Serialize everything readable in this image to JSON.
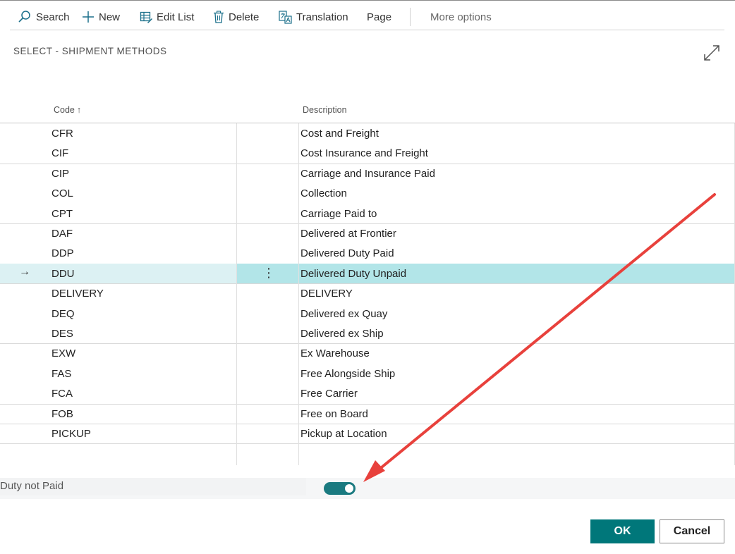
{
  "toolbar": {
    "search": "Search",
    "new": "New",
    "edit_list": "Edit List",
    "delete": "Delete",
    "translation": "Translation",
    "page": "Page",
    "more_options": "More options"
  },
  "page": {
    "title": "SELECT - SHIPMENT METHODS"
  },
  "grid": {
    "columns": {
      "code": "Code",
      "description": "Description"
    },
    "sort_indicator": "↑",
    "selected_marker": "→",
    "row_menu": "⋮",
    "rows": [
      {
        "code": "CFR",
        "description": "Cost and Freight"
      },
      {
        "code": "CIF",
        "description": "Cost Insurance and Freight"
      },
      {
        "code": "CIP",
        "description": "Carriage and Insurance Paid"
      },
      {
        "code": "COL",
        "description": "Collection"
      },
      {
        "code": "CPT",
        "description": "Carriage Paid to"
      },
      {
        "code": "DAF",
        "description": "Delivered at Frontier"
      },
      {
        "code": "DDP",
        "description": "Delivered Duty Paid"
      },
      {
        "code": "DDU",
        "description": "Delivered Duty Unpaid"
      },
      {
        "code": "DELIVERY",
        "description": "DELIVERY"
      },
      {
        "code": "DEQ",
        "description": "Delivered ex Quay"
      },
      {
        "code": "DES",
        "description": "Delivered ex Ship"
      },
      {
        "code": "EXW",
        "description": "Ex Warehouse"
      },
      {
        "code": "FAS",
        "description": "Free Alongside Ship"
      },
      {
        "code": "FCA",
        "description": "Free Carrier"
      },
      {
        "code": "FOB",
        "description": "Free on Board"
      },
      {
        "code": "PICKUP",
        "description": "Pickup at Location"
      }
    ],
    "selected_row": 7
  },
  "details": {
    "duty_not_paid_label": "Duty not Paid",
    "duty_not_paid_value": true
  },
  "actions": {
    "ok": "OK",
    "cancel": "Cancel"
  },
  "colors": {
    "accent": "#00777a",
    "selected_row": "#b2e5e8",
    "annotation_arrow": "#e8413c"
  },
  "icons": {
    "search": "search-icon",
    "new": "plus-icon",
    "edit_list": "edit-list-icon",
    "delete": "trash-icon",
    "translation": "translation-icon",
    "expand": "expand-icon"
  }
}
